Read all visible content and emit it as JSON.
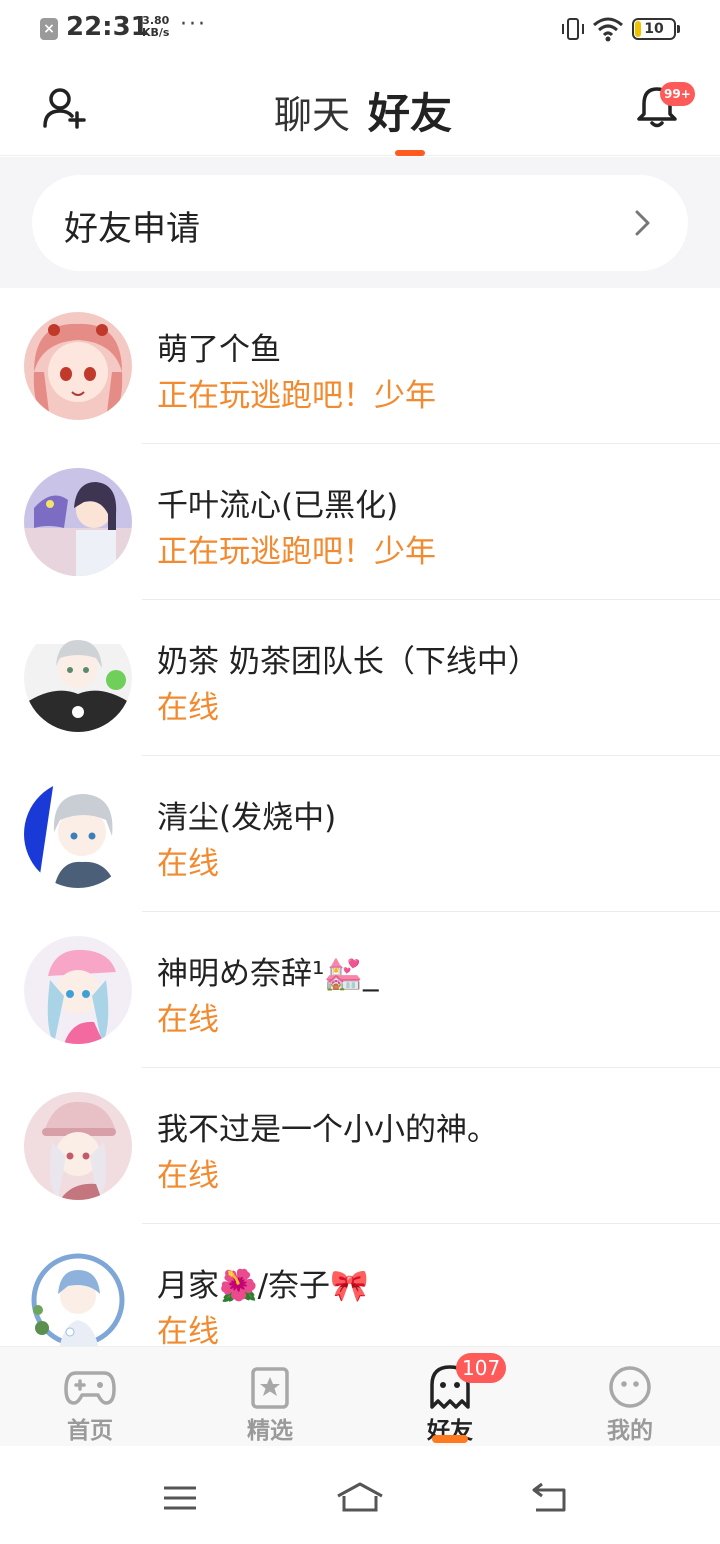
{
  "status_bar": {
    "time": "22:31",
    "speed_value": "3.80",
    "speed_unit": "KB/s",
    "battery": "10",
    "more": "···"
  },
  "header": {
    "tab_chat": "聊天",
    "tab_friends": "好友",
    "notification_badge": "99+"
  },
  "friend_request": {
    "label": "好友申请"
  },
  "friends": [
    {
      "name": "萌了个鱼",
      "status": "正在玩逃跑吧！少年"
    },
    {
      "name": "千叶流心(已黑化)",
      "status": "正在玩逃跑吧！少年"
    },
    {
      "name": "奶茶 奶茶团队长（下线中）",
      "status": "在线"
    },
    {
      "name": "清尘(发烧中)",
      "status": "在线"
    },
    {
      "name": "神明め奈辞¹💒_",
      "status": "在线"
    },
    {
      "name": "我不过是一个小小的神。",
      "status": "在线"
    },
    {
      "name": "月家🌺/奈子🎀",
      "status": "在线"
    }
  ],
  "bottom_nav": {
    "home": "首页",
    "featured": "精选",
    "friends": "好友",
    "friends_badge": "107",
    "me": "我的"
  },
  "colors": {
    "accent": "#ff5a1f",
    "status_orange": "#f28a2f",
    "badge_red": "#ff5a5a"
  }
}
